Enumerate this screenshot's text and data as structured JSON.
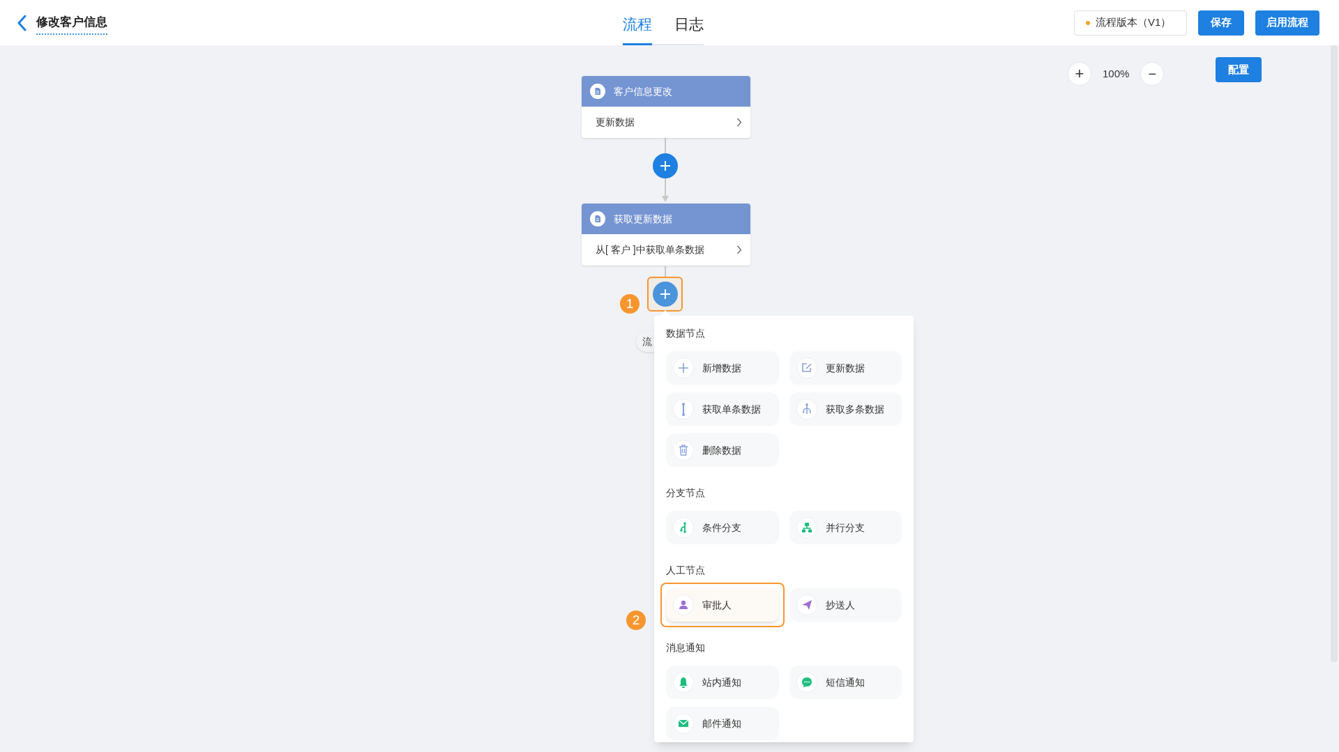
{
  "header": {
    "title": "修改客户信息",
    "tabs": [
      {
        "label": "流程",
        "selected": true
      },
      {
        "label": "日志",
        "selected": false
      }
    ],
    "version": "流程版本（V1）",
    "buttons": [
      "保存",
      "启用流程"
    ]
  },
  "canvas": {
    "zoom": {
      "zoom_in": "+",
      "value": "100%",
      "zoom_out": "−"
    },
    "config_button": "配置",
    "nodes": [
      {
        "title": "客户信息更改",
        "body": "更新数据"
      },
      {
        "title": "获取更新数据",
        "body": "从[ 客户 ]中获取单条数据"
      }
    ],
    "hidden_tag": "流",
    "callouts": [
      "1",
      "2"
    ]
  },
  "menu": {
    "sections": [
      {
        "title": "数据节点",
        "items": [
          {
            "kind": "add",
            "label": "新增数据",
            "selected": false
          },
          {
            "kind": "edit",
            "label": "更新数据",
            "selected": false
          },
          {
            "kind": "single",
            "label": "获取单条数据",
            "selected": false
          },
          {
            "kind": "multi",
            "label": "获取多条数据",
            "selected": false
          },
          {
            "kind": "delete",
            "label": "删除数据",
            "selected": false
          }
        ]
      },
      {
        "title": "分支节点",
        "items": [
          {
            "kind": "condition",
            "label": "条件分支",
            "selected": false
          },
          {
            "kind": "parallel",
            "label": "并行分支",
            "selected": false
          }
        ]
      },
      {
        "title": "人工节点",
        "items": [
          {
            "kind": "approver",
            "label": "审批人",
            "selected": true
          },
          {
            "kind": "cc",
            "label": "抄送人",
            "selected": false
          }
        ]
      },
      {
        "title": "消息通知",
        "items": [
          {
            "kind": "bell",
            "label": "站内通知",
            "selected": false
          },
          {
            "kind": "sms",
            "label": "短信通知",
            "selected": false
          },
          {
            "kind": "mail",
            "label": "邮件通知",
            "selected": false
          }
        ]
      }
    ]
  }
}
